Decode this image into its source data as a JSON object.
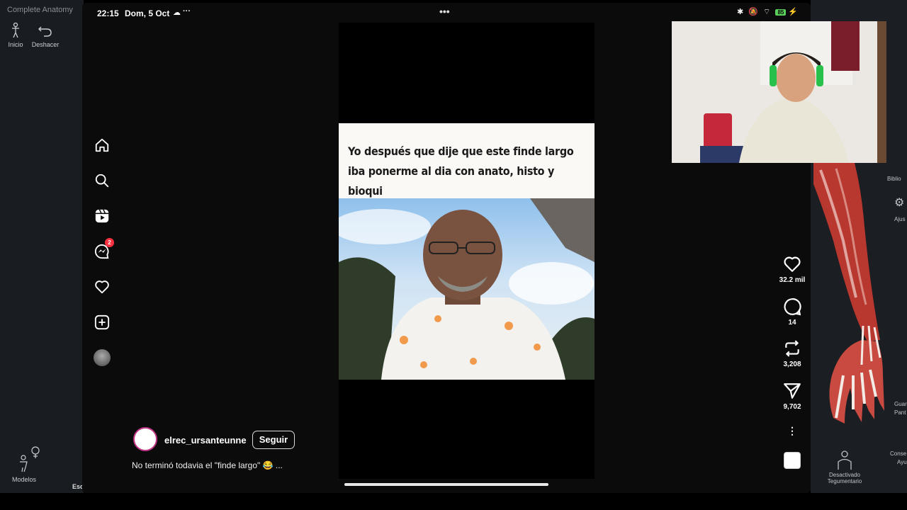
{
  "anatomy": {
    "app_title": "Complete Anatomy",
    "tools": [
      {
        "label": "Inicio",
        "icon": "human-figure-icon"
      },
      {
        "label": "Deshacer",
        "icon": "undo-icon"
      }
    ],
    "bottom_left": {
      "label": "Modelos",
      "icon": "female-symbol-icon",
      "partial_label": "Esq"
    },
    "right_labels": {
      "library": "Biblio",
      "settings": "Ajus",
      "save": "Guar",
      "screen": "Pant",
      "tips": "Conse",
      "help": "Ayu"
    },
    "tegument": {
      "line1": "Desactivado",
      "line2": "Tegumentario"
    }
  },
  "status_bar": {
    "time": "22:15",
    "date": "Dom, 5 Oct",
    "menu": "•••",
    "battery": "85"
  },
  "instagram": {
    "nav": [
      {
        "name": "home-icon"
      },
      {
        "name": "search-icon"
      },
      {
        "name": "reels-icon"
      },
      {
        "name": "messenger-icon",
        "badge": "2"
      },
      {
        "name": "heart-icon"
      },
      {
        "name": "create-icon"
      },
      {
        "name": "profile-avatar"
      }
    ],
    "reel": {
      "caption_text": "Yo después que dije que este finde largo iba ponerme al dia con anato, histo y bioqui",
      "username": "elrec_ursanteunne",
      "follow_label": "Seguir",
      "post_caption": "No terminó todavia el \"finde largo\" 😂 ..."
    },
    "actions": {
      "likes": "32.2 mil",
      "comments": "14",
      "reposts": "3,208",
      "shares": "9,702"
    }
  }
}
